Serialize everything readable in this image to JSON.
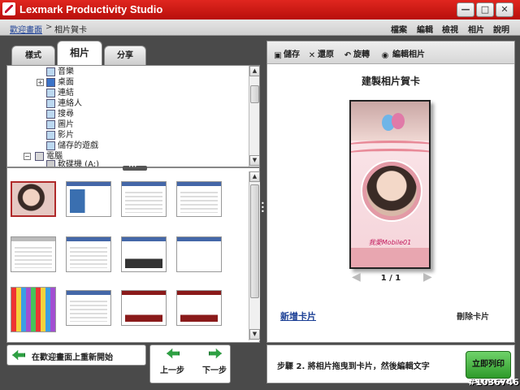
{
  "window": {
    "title": "Lexmark Productivity Studio",
    "controls": {
      "minimize": "—",
      "maximize": "□",
      "close": "✕"
    }
  },
  "breadcrumb": {
    "home": "歡迎畫面",
    "separator": ">",
    "current": "相片賀卡"
  },
  "menu": [
    "檔案",
    "編輯",
    "檢視",
    "相片",
    "說明"
  ],
  "tabs": [
    {
      "label": "樣式",
      "active": false
    },
    {
      "label": "相片",
      "active": true
    },
    {
      "label": "分享",
      "active": false
    }
  ],
  "tree": {
    "items": [
      {
        "label": "音樂",
        "expander": ""
      },
      {
        "label": "桌面",
        "expander": "+"
      },
      {
        "label": "連結",
        "expander": ""
      },
      {
        "label": "連絡人",
        "expander": ""
      },
      {
        "label": "搜尋",
        "expander": ""
      },
      {
        "label": "圖片",
        "expander": ""
      },
      {
        "label": "影片",
        "expander": ""
      },
      {
        "label": "儲存的遊戲",
        "expander": ""
      },
      {
        "label": "電腦",
        "expander": "−"
      },
      {
        "label": "軟碟機 (A:)",
        "expander": ""
      }
    ]
  },
  "splitter_label": "▾▾▾",
  "toolbar": {
    "save": "儲存",
    "restore": "還原",
    "rotate": "旋轉",
    "edit_photo": "編輯相片"
  },
  "card": {
    "title": "建製相片賀卡",
    "caption": "我愛Mobile01",
    "page": "1 / 1",
    "add_card": "新增卡片",
    "delete_card": "刪除卡片"
  },
  "bottom": {
    "restart": "在歡迎畫面上重新開始",
    "prev": "上一步",
    "next": "下一步",
    "step": "步驟 2. 將相片拖曳到卡片，然後編輯文字",
    "print": "立即列印"
  },
  "watermark": "#1036746",
  "colors": {
    "title_bar": "#c8102e",
    "accent_green": "#2ea043",
    "link_blue": "#1b3f95"
  }
}
